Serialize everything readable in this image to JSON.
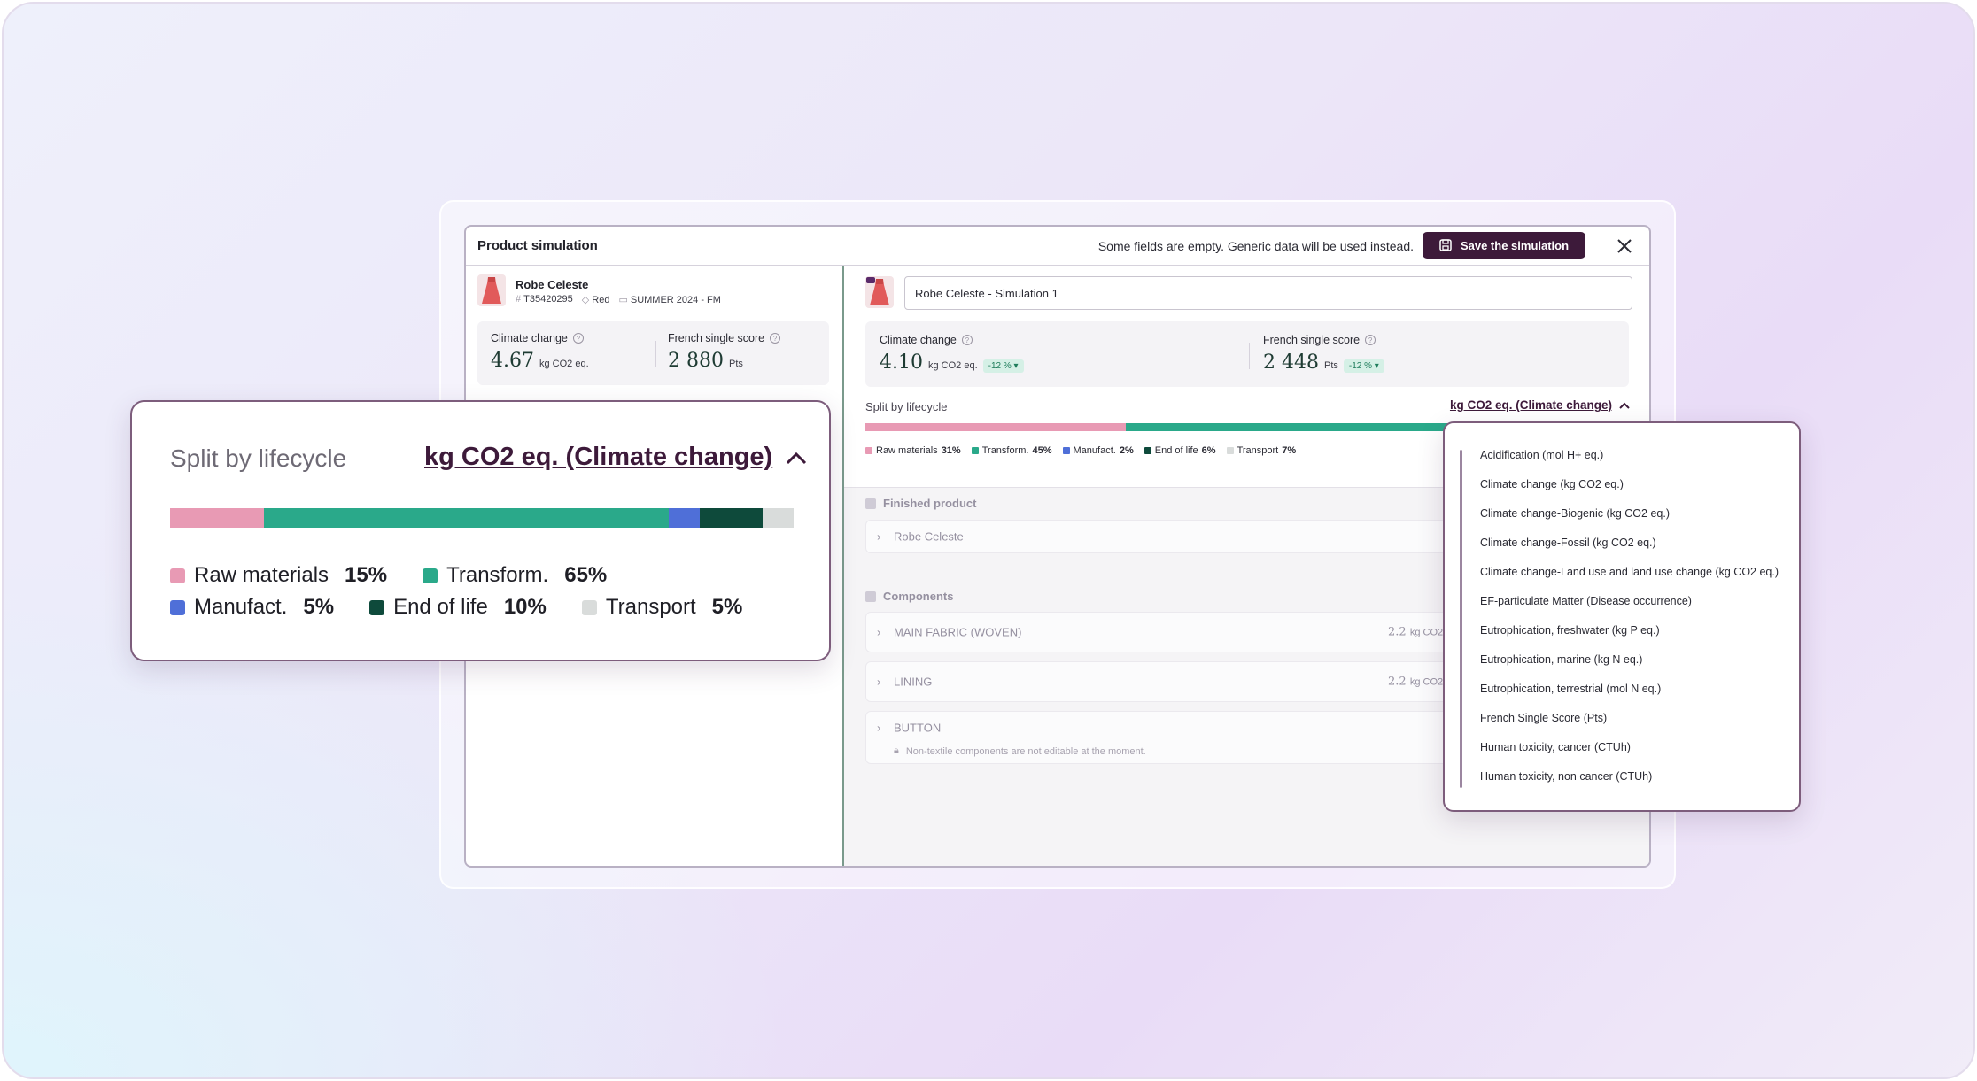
{
  "header": {
    "title": "Product simulation",
    "hint": "Some fields are empty. Generic data will be used instead.",
    "save_label": "Save the simulation"
  },
  "product": {
    "name": "Robe Celeste",
    "ref": "T35420295",
    "color": "Red",
    "collection": "SUMMER 2024 - FM"
  },
  "original_metrics": {
    "climate_label": "Climate change",
    "climate_value": "4.67",
    "climate_unit": "kg CO2 eq.",
    "score_label": "French single score",
    "score_value": "2 880",
    "score_unit": "Pts"
  },
  "simulation": {
    "name_value": "Robe Celeste - Simulation 1",
    "climate_label": "Climate change",
    "climate_value": "4.10",
    "climate_unit": "kg CO2 eq.",
    "climate_delta": "-12 % ▾",
    "score_label": "French single score",
    "score_value": "2 448",
    "score_unit": "Pts",
    "score_delta": "-12 % ▾"
  },
  "split_small": {
    "label": "Split by lifecycle",
    "selector": "kg CO2 eq. (Climate change)",
    "segments": [
      {
        "name": "Raw materials",
        "pct": "31%",
        "value": 31,
        "color": "#e89ab4"
      },
      {
        "name": "Transform.",
        "pct": "45%",
        "value": 45,
        "color": "#2aa98a"
      },
      {
        "name": "Manufact.",
        "pct": "2%",
        "value": 2,
        "color": "#4f6fd8"
      },
      {
        "name": "End of life",
        "pct": "6%",
        "value": 6,
        "color": "#0e4a3b"
      },
      {
        "name": "Transport",
        "pct": "7%",
        "value": 7,
        "color": "#d9dcdb"
      }
    ]
  },
  "sections": {
    "finished_label": "Finished product",
    "finished_item": "Robe Celeste",
    "components_label": "Components",
    "components": [
      {
        "name": "MAIN FABRIC (WOVEN)",
        "value": "2.2",
        "unit": "kg CO2"
      },
      {
        "name": "LINING",
        "value": "2.2",
        "unit": "kg CO2"
      }
    ],
    "button_name": "BUTTON",
    "button_note": "Non-textile components are not editable at the moment."
  },
  "callout": {
    "label": "Split by lifecycle",
    "selector": "kg CO2 eq. (Climate change)",
    "segments": [
      {
        "name": "Raw materials",
        "pct": "15%",
        "value": 15,
        "color": "#e89ab4"
      },
      {
        "name": "Transform.",
        "pct": "65%",
        "value": 65,
        "color": "#2aa98a"
      },
      {
        "name": "Manufact.",
        "pct": "5%",
        "value": 5,
        "color": "#4f6fd8"
      },
      {
        "name": "End of life",
        "pct": "10%",
        "value": 10,
        "color": "#0e4a3b"
      },
      {
        "name": "Transport",
        "pct": "5%",
        "value": 5,
        "color": "#d9dcdb"
      }
    ]
  },
  "dropdown": {
    "options": [
      "Acidification (mol H+ eq.)",
      "Climate change (kg CO2 eq.)",
      "Climate change-Biogenic (kg CO2 eq.)",
      "Climate change-Fossil (kg CO2 eq.)",
      "Climate change-Land use and land use change (kg CO2 eq.)",
      "EF-particulate Matter (Disease occurrence)",
      "Eutrophication, freshwater (kg P eq.)",
      "Eutrophication, marine (kg N eq.)",
      "Eutrophication, terrestrial (mol N eq.)",
      "French Single Score (Pts)",
      "Human toxicity, cancer (CTUh)",
      "Human toxicity, non cancer (CTUh)"
    ]
  },
  "icons": {
    "save": "save-icon",
    "close": "close-icon",
    "chevron_up": "chevron-up-icon",
    "chevron_right": "chevron-right-icon",
    "help": "help-icon"
  }
}
